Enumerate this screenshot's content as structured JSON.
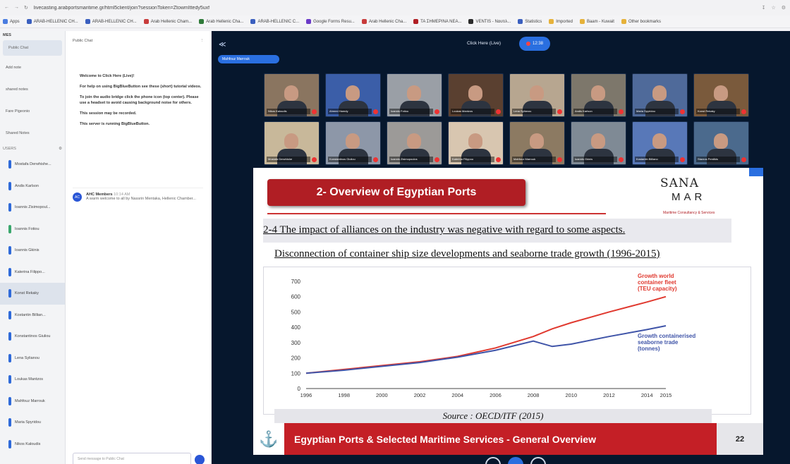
{
  "browser": {
    "url": "livecasting.arabportsmaritime.gr/html5client/join?sessionToken=ZtowmIttedy5uxf",
    "nav_icons": [
      "back-icon",
      "forward-icon",
      "reload-icon"
    ],
    "right_icons": [
      "download-icon",
      "star-icon",
      "settings-icon"
    ]
  },
  "bookmarks": [
    {
      "label": "Apps",
      "color": "#4a7ce0"
    },
    {
      "label": "ARAB-HELLENIC CH...",
      "color": "#3a5fbf"
    },
    {
      "label": "ARAB-HELLENIC CH...",
      "color": "#3a5fbf"
    },
    {
      "label": "Arab Hellenic Cham...",
      "color": "#c83b3b"
    },
    {
      "label": "Arab Hellenic Cha...",
      "color": "#2f7a39"
    },
    {
      "label": "ARAB-HELLENIC C...",
      "color": "#3a5fbf"
    },
    {
      "label": "Google Forms Resu...",
      "color": "#6a3ac8"
    },
    {
      "label": "Arab Hellenic Cha...",
      "color": "#c83b3b"
    },
    {
      "label": "ΤΑ ΣΗΜΕΡΙΝΑ ΝΕΑ...",
      "color": "#b01e24"
    },
    {
      "label": "VENTIS - Ναυτιλ...",
      "color": "#2b2b2b"
    },
    {
      "label": "Statistics",
      "color": "#3a5fbf"
    },
    {
      "label": "Imported",
      "color": "#e6b23a"
    },
    {
      "label": "Baam - Kuwait",
      "color": "#e6b23a"
    },
    {
      "label": "Other bookmarks",
      "color": "#e6b23a"
    }
  ],
  "users_panel": {
    "header": "MES",
    "public_chat": "Public Chat",
    "links": [
      "Add note",
      "shared notes",
      "Fare Pigeonio"
    ],
    "shared_notes": "Shared Notes",
    "users_header": "USERS",
    "users": [
      {
        "name": "Mostafa Derwhishe...",
        "active": false,
        "green": false
      },
      {
        "name": "Andis Karlson",
        "active": false,
        "green": false
      },
      {
        "name": "Ioannis Zisimopoul...",
        "active": false,
        "green": false
      },
      {
        "name": "Ioannis Fotiou",
        "active": false,
        "green": true
      },
      {
        "name": "Ioannis Gkinis",
        "active": false,
        "green": false
      },
      {
        "name": "Katerina Filippo...",
        "active": false,
        "green": false
      },
      {
        "name": "Konst Rekaky",
        "active": true,
        "green": false
      },
      {
        "name": "Kostantin Billian...",
        "active": false,
        "green": false
      },
      {
        "name": "Konstantinos Giuliou",
        "active": false,
        "green": false
      },
      {
        "name": "Lena Sylianou",
        "active": false,
        "green": false
      },
      {
        "name": "Loukas Mantzos",
        "active": false,
        "green": false
      },
      {
        "name": "Mahfouz Marrouk",
        "active": false,
        "green": false
      },
      {
        "name": "Maria Spyridou",
        "active": false,
        "green": false
      },
      {
        "name": "Nikos Kaloudis",
        "active": false,
        "green": false
      }
    ]
  },
  "chat": {
    "title": "Public Chat",
    "line1": "Welcome to Click Here (Live)!",
    "line2": "For help on using BigBlueButton see these (short) tutorial videos.",
    "line3": "To join the audio bridge click the phone icon (top center). Please use a headset to avoid causing background noise for others.",
    "line4": "This session may be recorded.",
    "line5": "This server is running BigBlueButton.",
    "welcome_avatar": "AC",
    "welcome_author": "AHC Members",
    "welcome_time": "10:14 AM",
    "welcome_text": "A warm welcome to all by Nassrin Mentaka, Hellenic Chamber...",
    "input_placeholder": "Send message to Public Chat"
  },
  "meeting": {
    "title": "Click Here (Live)",
    "rec_time": "12:38",
    "talking": "Mahfouz Marrouk",
    "tiles": [
      {
        "name": "Nikos Kaloudis",
        "bg": "#8a7560"
      },
      {
        "name": "Ahmed Hamdy",
        "bg": "#3b5ea8"
      },
      {
        "name": "Ioannis Fotiou",
        "bg": "#9a9fa6"
      },
      {
        "name": "Loukas Mantzos",
        "bg": "#5a4030"
      },
      {
        "name": "Lena Sylianou",
        "bg": "#b7a690"
      },
      {
        "name": "Andis Karlson",
        "bg": "#7d776b"
      },
      {
        "name": "Maria Spyridou",
        "bg": "#4f6a9a"
      },
      {
        "name": "Konst Rekaky",
        "bg": "#7a5a3c"
      },
      {
        "name": "Mostafa Derwhishe",
        "bg": "#c8b89a"
      },
      {
        "name": "Konstantinos Giuliou",
        "bg": "#8d97a8"
      },
      {
        "name": "Ioannis Zisimopoulos",
        "bg": "#9c9a98"
      },
      {
        "name": "Katerina Filippou",
        "bg": "#d8c6b0"
      },
      {
        "name": "Mahfouz Marrouk",
        "bg": "#8c7a62"
      },
      {
        "name": "Ioannis Gkinis",
        "bg": "#7f8a95"
      },
      {
        "name": "Kostantin Billiano",
        "bg": "#5878b8"
      },
      {
        "name": "Stavros Perdikis",
        "bg": "#4b6a8d"
      }
    ]
  },
  "slide": {
    "title": "2- Overview of Egyptian Ports",
    "logo_top": "SANA",
    "logo_bottom": "MAR",
    "logo_tag": "Maritime Consultancy & Services",
    "subtitle": "2-4 The impact of alliances on the industry was negative with regard to some aspects.",
    "chart_title": "Disconnection of container ship size developments and seaborne trade growth (1996-2015)",
    "source": "Source : OECD/ITF (2015)",
    "footer": "Egyptian Ports & Selected Maritime Services - General Overview",
    "page": "22"
  },
  "chart_data": {
    "type": "line",
    "title": "Disconnection of container ship size developments and seaborne trade growth (1996-2015)",
    "x": [
      1996,
      1998,
      2000,
      2002,
      2004,
      2006,
      2008,
      2009,
      2010,
      2012,
      2014,
      2015
    ],
    "x_tick_labels": [
      "1996",
      "1998",
      "2000",
      "2002",
      "2004",
      "2006",
      "2008",
      "2010",
      "2012",
      "2014",
      "2015"
    ],
    "y_ticks": [
      0,
      100,
      200,
      300,
      400,
      500,
      600,
      700
    ],
    "ylim": [
      0,
      700
    ],
    "xlim": [
      1996,
      2015
    ],
    "series": [
      {
        "name": "Growth world container fleet (TEU capacity)",
        "color": "#e0392f",
        "values": [
          100,
          125,
          150,
          175,
          210,
          265,
          340,
          390,
          430,
          500,
          565,
          600
        ]
      },
      {
        "name": "Growth containerised seaborne trade (tonnes)",
        "color": "#3f54a8",
        "values": [
          100,
          120,
          145,
          170,
          205,
          250,
          310,
          275,
          290,
          340,
          385,
          410
        ]
      }
    ]
  }
}
